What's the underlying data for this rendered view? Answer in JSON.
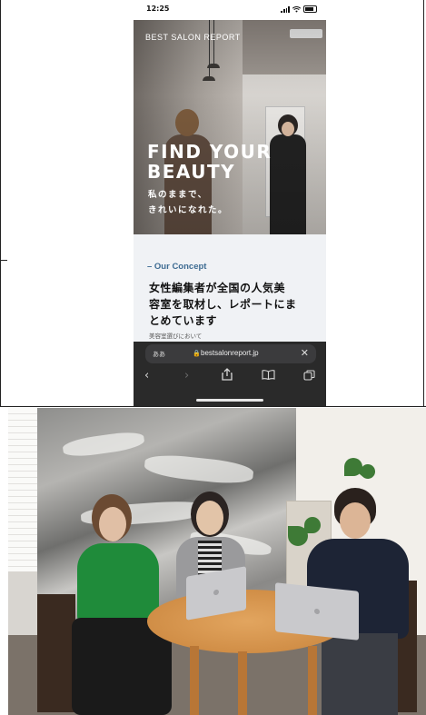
{
  "status_bar": {
    "time": "12:25",
    "icons": [
      "signal-icon",
      "wifi-icon",
      "battery-icon"
    ]
  },
  "hero": {
    "brand": "BEST SALON REPORT",
    "title": "FIND YOUR\nBEAUTY",
    "subtitle": "私のままで、\nきれいになれた。"
  },
  "concept": {
    "label": "– Our Concept",
    "heading": "女性編集者が全国の人気美\n容室を取材し、レポートにま\nとめています",
    "body_preview": "美容室選びにおいて"
  },
  "safari": {
    "aa_label": "ああ",
    "url": "bestsalonreport.jp",
    "close_symbol": "✕",
    "toolbar": {
      "back": "‹",
      "forward": "›",
      "share": "⇪",
      "bookmarks": "📖",
      "tabs": "⧉"
    }
  },
  "colors": {
    "concept_accent": "#3d6b92",
    "concept_bg": "#f0f2f5",
    "safari_bar": "#2a2a2a"
  }
}
